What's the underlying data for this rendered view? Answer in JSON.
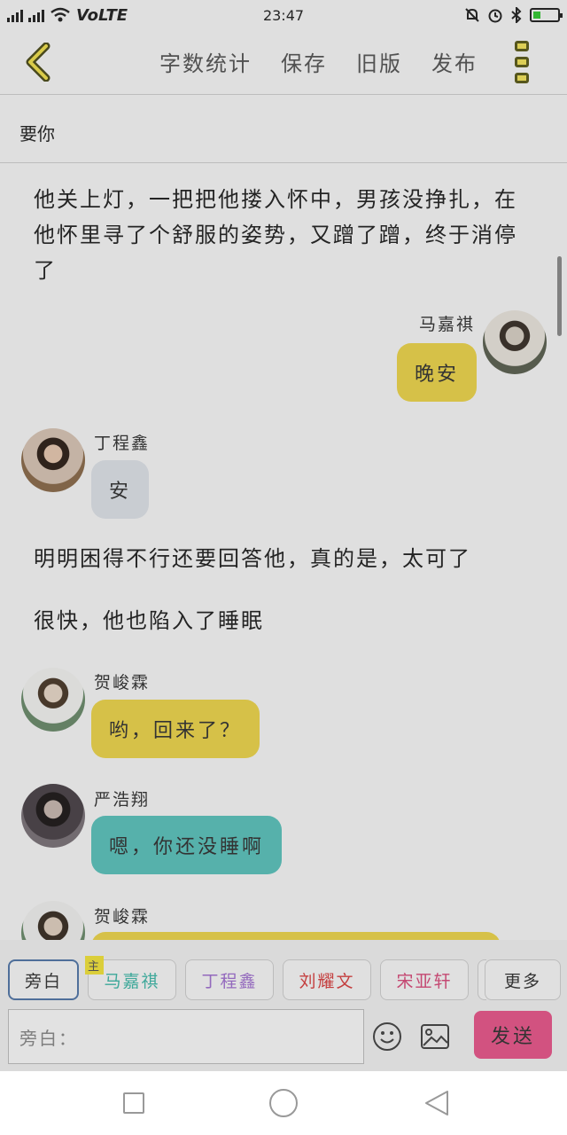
{
  "status_bar": {
    "network": "4G 3G",
    "volte": "VoLTE",
    "time": "23:47"
  },
  "toolbar": {
    "word_count": "字数统计",
    "save": "保存",
    "old_version": "旧版",
    "publish": "发布"
  },
  "chapter_title": "要你",
  "messages": {
    "n1": "他关上灯，一把把他搂入怀中，男孩没挣扎，在他怀里寻了个舒服的姿势，又蹭了蹭，终于消停了",
    "m1_speaker": "马嘉祺",
    "m1_text": "晚安",
    "m2_speaker": "丁程鑫",
    "m2_text": "安",
    "n2": "明明困得不行还要回答他，真的是，太可了",
    "n3": "很快，他也陷入了睡眠",
    "m3_speaker": "贺峻霖",
    "m3_text": "哟，回来了？",
    "m4_speaker": "严浩翔",
    "m4_text": "嗯，你还没睡啊",
    "m5_speaker": "贺峻霖"
  },
  "characters": {
    "narration": "旁白",
    "main_badge": "主",
    "c1": "马嘉祺",
    "c2": "丁程鑫",
    "c3": "刘耀文",
    "c4": "宋亚轩",
    "more": "更多"
  },
  "input": {
    "placeholder": "旁白：",
    "send": "发送"
  },
  "colors": {
    "yellow_bubble": "#ecd44a",
    "gray_bubble": "#dde2e8",
    "teal_bubble": "#5bc2bb",
    "send": "#e8568a",
    "c1": "#3fb8a8",
    "c2": "#a070d0",
    "c3": "#d84040",
    "c4": "#d84a7a"
  }
}
